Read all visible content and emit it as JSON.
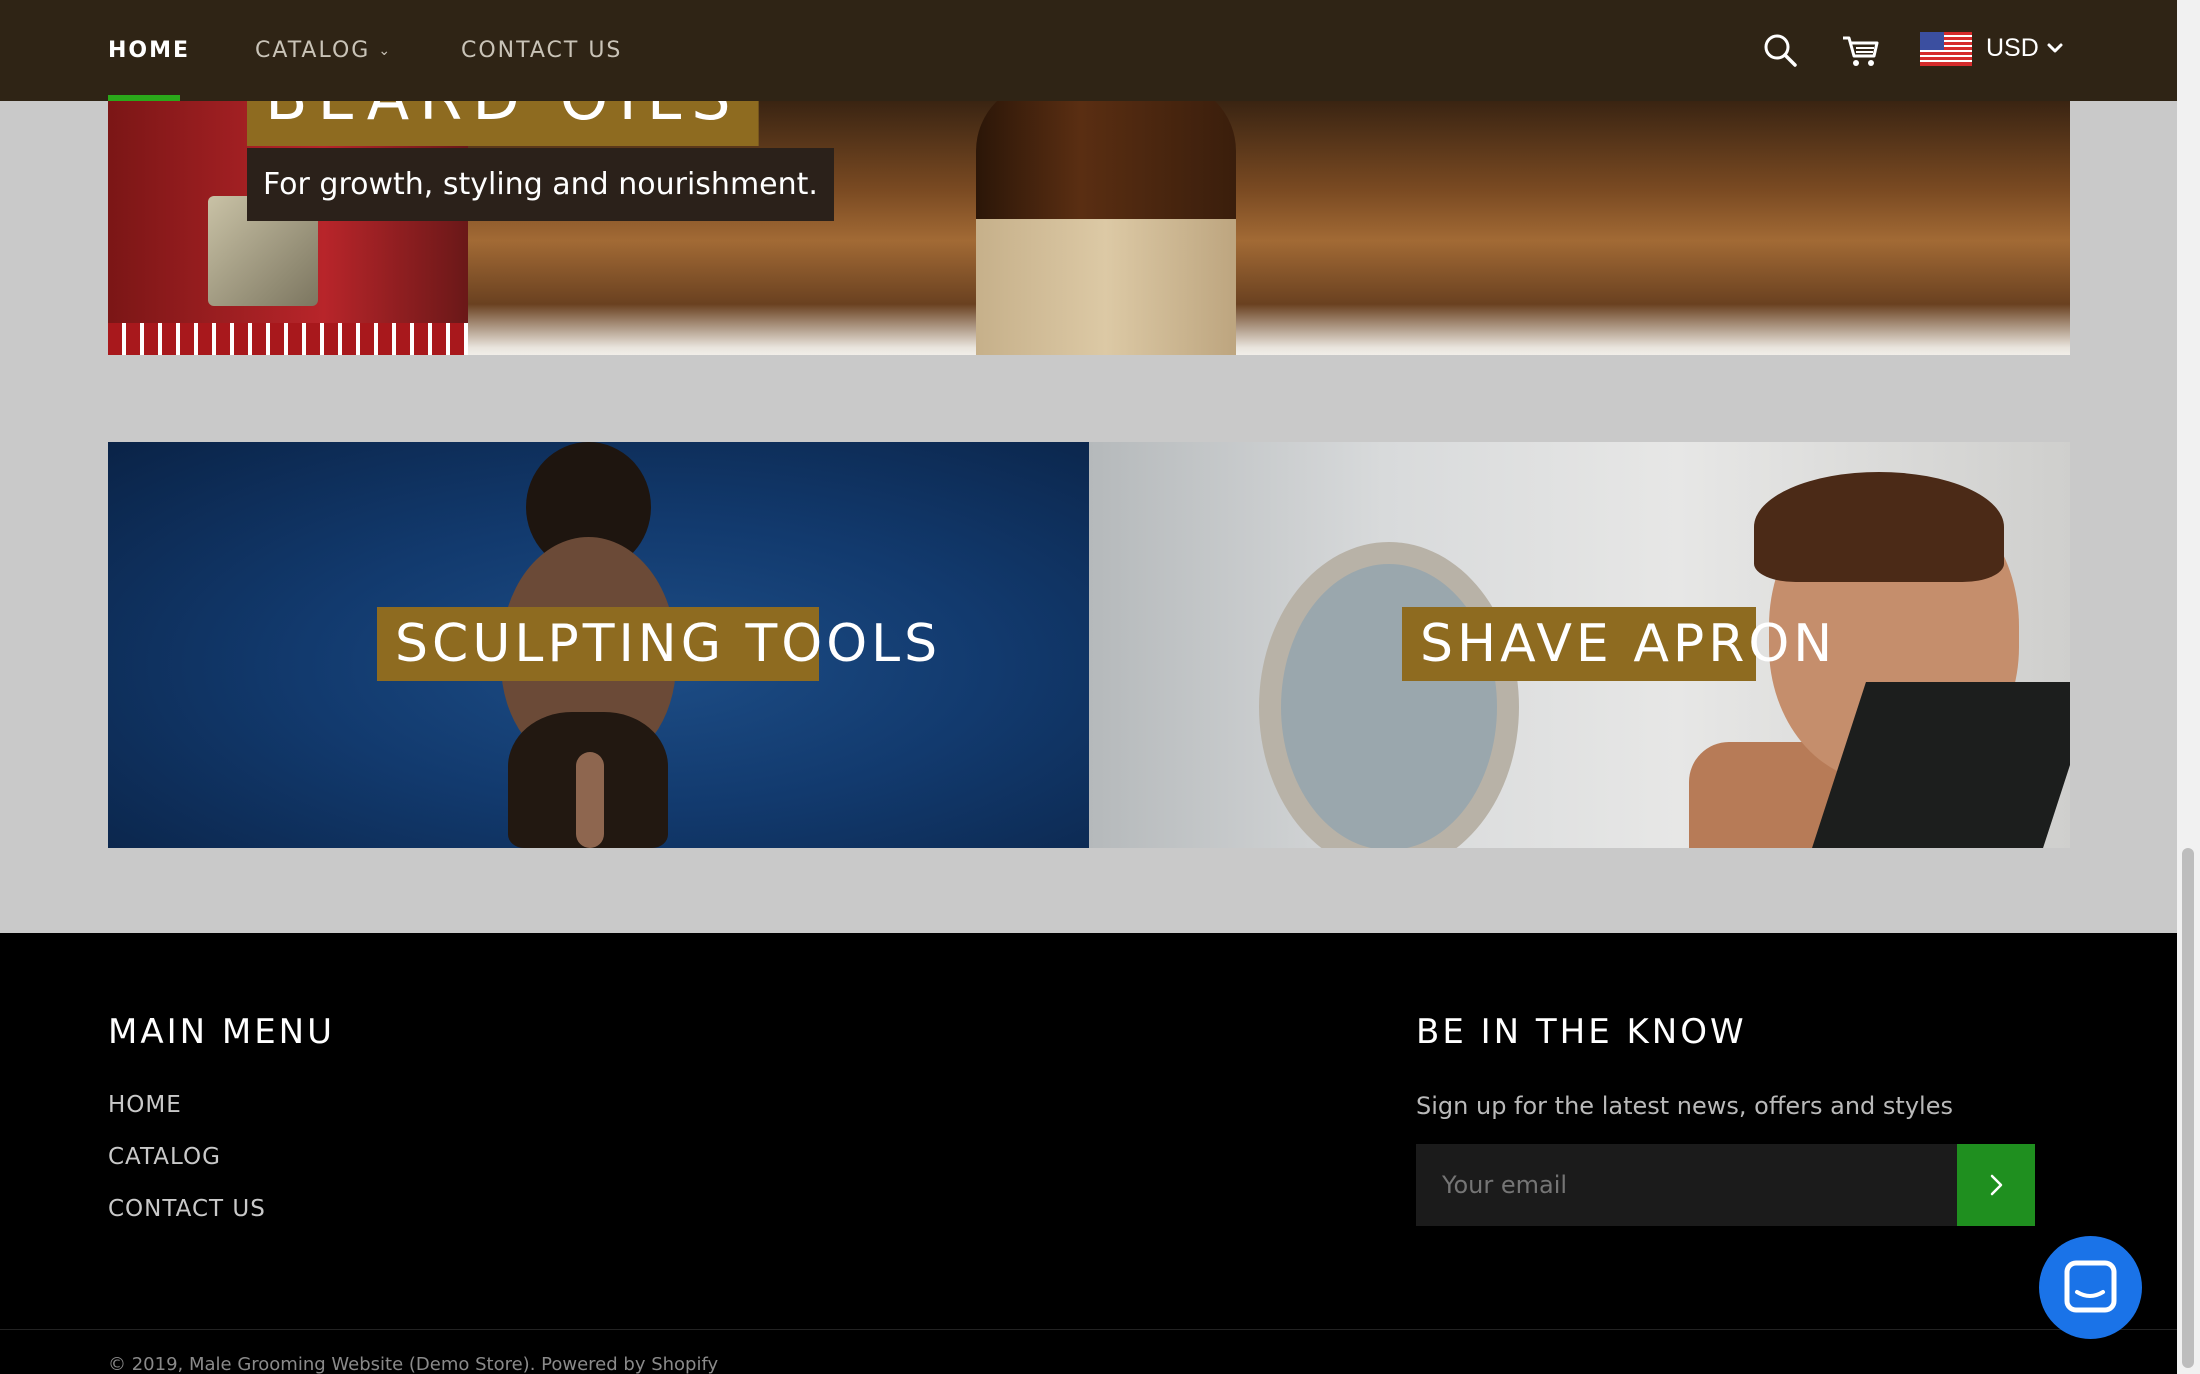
{
  "header": {
    "nav": [
      {
        "label": "HOME",
        "active": true
      },
      {
        "label": "CATALOG",
        "has_dropdown": true
      },
      {
        "label": "CONTACT US"
      }
    ],
    "icons": [
      "search-icon",
      "cart-icon",
      "us-flag-icon",
      "chevron-down-icon"
    ],
    "currency": "USD",
    "accent_color": "#2aa81a",
    "background": "#2f2415"
  },
  "hero": {
    "title": "BEARD OILS",
    "subtitle": "For growth, styling and nourishment."
  },
  "tiles": [
    {
      "label": "SCULPTING TOOLS"
    },
    {
      "label": "SHAVE APRON"
    }
  ],
  "label_color": "#8e6b20",
  "footer": {
    "menu_heading": "MAIN MENU",
    "menu_links": [
      "HOME",
      "CATALOG",
      "CONTACT US"
    ],
    "newsletter_heading": "BE IN THE KNOW",
    "newsletter_text": "Sign up for the latest news, offers and styles",
    "email_placeholder": "Your email",
    "submit_icon": "chevron-right-icon",
    "submit_color": "#1f8f1f",
    "copyright": "© 2019, Male Grooming Website (Demo Store). Powered by Shopify"
  },
  "chat": {
    "icon": "chat-icon",
    "color": "#1a73e8"
  }
}
